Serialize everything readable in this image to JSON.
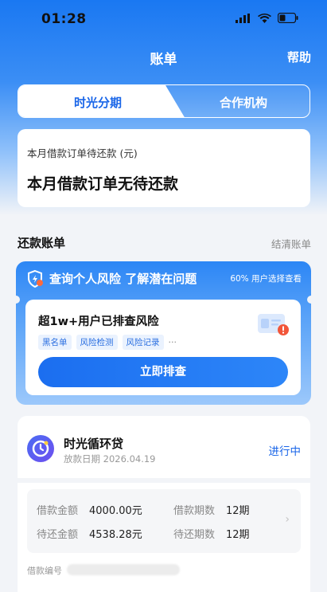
{
  "status_bar": {
    "time": "01:28"
  },
  "header": {
    "title": "账单",
    "help": "帮助"
  },
  "tabs": [
    {
      "label": "时光分期",
      "active": true
    },
    {
      "label": "合作机构",
      "active": false
    }
  ],
  "due_card": {
    "subtitle": "本月借款订单待还款 (元)",
    "message": "本月借款订单无待还款"
  },
  "section": {
    "title": "还款账单",
    "link": "结清账单"
  },
  "risk_banner": {
    "title": "查询个人风险 了解潜在问题",
    "note": "60% 用户选择查看",
    "inner_title": "超1w+用户已排查风险",
    "tags": [
      "黑名单",
      "风险检测",
      "风险记录"
    ],
    "more": "···",
    "button": "立即排查"
  },
  "loan": {
    "name": "时光循环贷",
    "release_date": "放款日期 2026.04.19",
    "status": "进行中",
    "details": {
      "amount_label": "借款金额",
      "amount_value": "4000.00元",
      "periods_label": "借款期数",
      "periods_value": "12期",
      "pending_label": "待还金额",
      "pending_value": "4538.28元",
      "pending_periods_label": "待还期数",
      "pending_periods_value": "12期"
    },
    "loan_no_label": "借款编号"
  },
  "colors": {
    "brand_blue": "#1a66e8",
    "header_blue": "#1a78f2"
  }
}
